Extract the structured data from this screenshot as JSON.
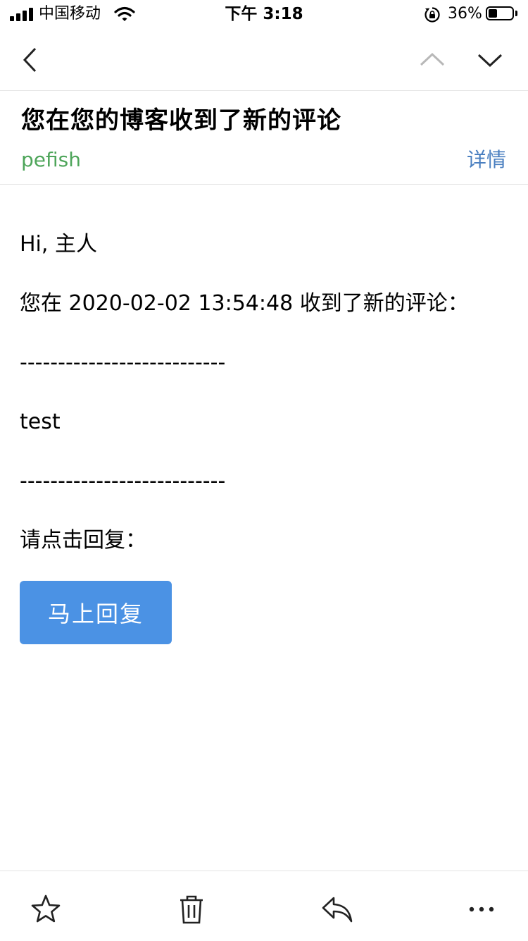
{
  "status_bar": {
    "carrier": "中国移动",
    "time": "下午 3:18",
    "battery_percent": "36%",
    "battery_level": 0.36,
    "icons": [
      "signal-icon",
      "wifi-icon",
      "rotation-lock-icon",
      "battery-icon"
    ]
  },
  "nav": {
    "icons": [
      "back-icon",
      "previous-mail-icon",
      "next-mail-icon"
    ]
  },
  "mail": {
    "subject": "您在您的博客收到了新的评论",
    "sender": "pefish",
    "details_label": "详情"
  },
  "body": {
    "greeting": "Hi, 主人",
    "notice": "您在 2020-02-02 13:54:48 收到了新的评论：",
    "separator_top": "---------------------------",
    "comment": "test",
    "separator_bottom": "---------------------------",
    "prompt": "请点击回复：",
    "reply_button": "马上回复"
  },
  "toolbar": {
    "icons": [
      "star-icon",
      "trash-icon",
      "reply-icon",
      "more-icon"
    ]
  },
  "colors": {
    "sender": "#4ea55a",
    "details": "#4a7fc0",
    "button": "#4b92e4"
  }
}
